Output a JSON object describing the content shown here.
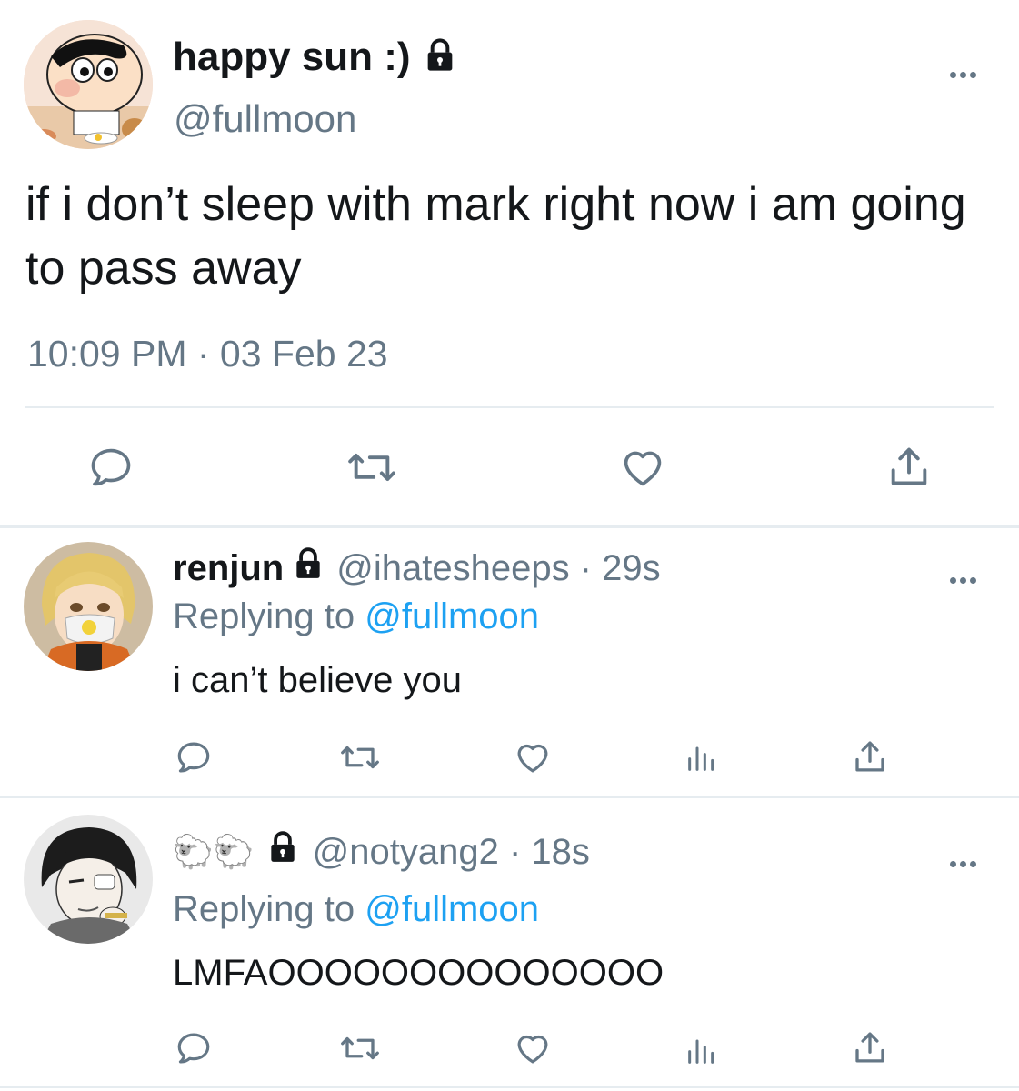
{
  "main_tweet": {
    "display_name": "happy sun :)",
    "handle": "@fullmoon",
    "text": "if i don’t sleep with mark right now i am going to pass away",
    "timestamp": "10:09 PM · 03 Feb 23"
  },
  "replies": [
    {
      "display_name": "renjun",
      "handle": "@ihatesheeps",
      "time": " · 29s",
      "replying_prefix": "Replying to ",
      "replying_to": "@fullmoon",
      "text": "i can’t believe you"
    },
    {
      "display_name": "🐑🐑",
      "handle": "@notyang2",
      "time": " · 18s",
      "replying_prefix": "Replying to ",
      "replying_to": "@fullmoon",
      "text": "LMFAOOOOOOOOOOOOOO"
    }
  ],
  "icons": {
    "reply": "reply-icon",
    "retweet": "retweet-icon",
    "like": "heart-icon",
    "analytics": "analytics-icon",
    "share": "share-icon",
    "lock": "lock-icon",
    "more": "more-icon"
  },
  "colors": {
    "text": "#14171a",
    "secondary": "#657786",
    "link": "#1da1f2",
    "divider": "#e6ecf0"
  }
}
